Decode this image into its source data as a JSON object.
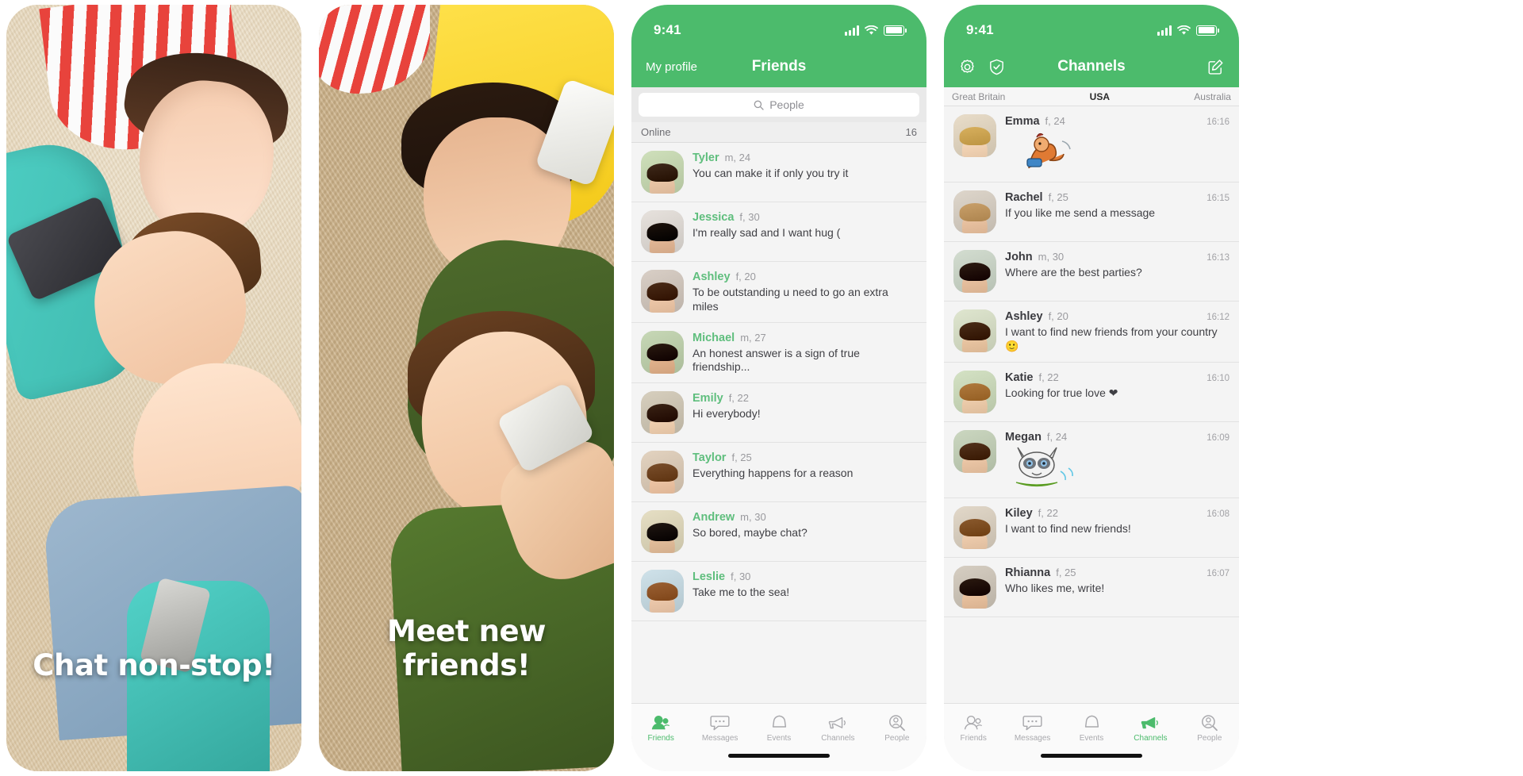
{
  "brand_color": "#4cbb6c",
  "name_color": "#5fbe7d",
  "promo_screens": [
    {
      "caption": "Chat non-stop!"
    },
    {
      "caption": "Meet new friends!"
    }
  ],
  "friends_screen": {
    "status": {
      "time": "9:41",
      "signal_icon": "signal-bars-icon",
      "wifi_icon": "wifi-icon",
      "battery_icon": "battery-icon"
    },
    "nav": {
      "left_label": "My profile",
      "title": "Friends"
    },
    "search": {
      "icon": "search-icon",
      "placeholder": "People"
    },
    "section": {
      "label": "Online",
      "count": "16"
    },
    "rows": [
      {
        "name": "Tyler",
        "meta": "m, 24",
        "message": "You can make it if only you try it"
      },
      {
        "name": "Jessica",
        "meta": "f, 30",
        "message": "I'm really sad and I want hug ("
      },
      {
        "name": "Ashley",
        "meta": "f, 20",
        "message": "To be outstanding u need to go an extra miles"
      },
      {
        "name": "Michael",
        "meta": "m, 27",
        "message": "An honest answer is a sign of true friendship..."
      },
      {
        "name": "Emily",
        "meta": "f, 22",
        "message": "Hi everybody!"
      },
      {
        "name": "Taylor",
        "meta": "f, 25",
        "message": "Everything happens for a reason"
      },
      {
        "name": "Andrew",
        "meta": "m, 30",
        "message": "So bored, maybe chat?"
      },
      {
        "name": "Leslie",
        "meta": "f, 30",
        "message": "Take me to the sea!"
      }
    ],
    "tabs": [
      {
        "label": "Friends",
        "icon": "friends-icon",
        "active": true
      },
      {
        "label": "Messages",
        "icon": "messages-icon",
        "active": false
      },
      {
        "label": "Events",
        "icon": "events-icon",
        "active": false
      },
      {
        "label": "Channels",
        "icon": "channels-icon",
        "active": false
      },
      {
        "label": "People",
        "icon": "people-icon",
        "active": false
      }
    ]
  },
  "channels_screen": {
    "status": {
      "time": "9:41",
      "signal_icon": "signal-bars-icon",
      "wifi_icon": "wifi-icon",
      "battery_icon": "battery-icon"
    },
    "nav": {
      "title": "Channels",
      "settings_icon": "gear-icon",
      "shield_icon": "shield-check-icon",
      "compose_icon": "compose-icon"
    },
    "country_tabs": [
      {
        "label": "Great Britain",
        "active": false
      },
      {
        "label": "USA",
        "active": true
      },
      {
        "label": "Australia",
        "active": false
      }
    ],
    "rows": [
      {
        "name": "Emma",
        "meta": "f, 24",
        "time": "16:16",
        "message": "",
        "sticker": "squirrel-sticker"
      },
      {
        "name": "Rachel",
        "meta": "f, 25",
        "time": "16:15",
        "message": "If you like me send a message",
        "sticker": ""
      },
      {
        "name": "John",
        "meta": "m, 30",
        "time": "16:13",
        "message": "Where are the best parties?",
        "sticker": ""
      },
      {
        "name": "Ashley",
        "meta": "f, 20",
        "time": "16:12",
        "message": "I want to find new friends from your country 🙂",
        "sticker": ""
      },
      {
        "name": "Katie",
        "meta": "f, 22",
        "time": "16:10",
        "message": "Looking for true love ❤",
        "sticker": ""
      },
      {
        "name": "Megan",
        "meta": "f, 24",
        "time": "16:09",
        "message": "",
        "sticker": "raccoon-sticker"
      },
      {
        "name": "Kiley",
        "meta": "f, 22",
        "time": "16:08",
        "message": "I want to find new friends!",
        "sticker": ""
      },
      {
        "name": "Rhianna",
        "meta": "f, 25",
        "time": "16:07",
        "message": "Who likes me, write!",
        "sticker": ""
      }
    ],
    "tabs": [
      {
        "label": "Friends",
        "icon": "friends-icon",
        "active": false
      },
      {
        "label": "Messages",
        "icon": "messages-icon",
        "active": false
      },
      {
        "label": "Events",
        "icon": "events-icon",
        "active": false
      },
      {
        "label": "Channels",
        "icon": "channels-icon",
        "active": true
      },
      {
        "label": "People",
        "icon": "people-icon",
        "active": false
      }
    ]
  }
}
